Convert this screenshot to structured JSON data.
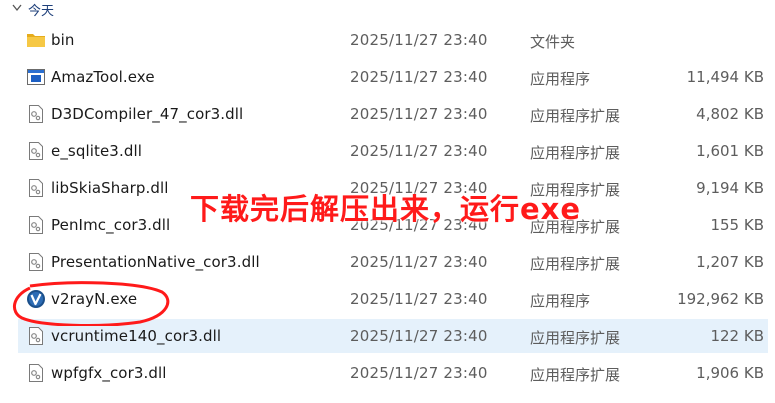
{
  "group": {
    "title": "今天"
  },
  "files": [
    {
      "name": "bin",
      "date": "2025/11/27 23:40",
      "type": "文件夹",
      "size": "",
      "icon": "folder-icon"
    },
    {
      "name": "AmazTool.exe",
      "date": "2025/11/27 23:40",
      "type": "应用程序",
      "size": "11,494 KB",
      "icon": "app-window-icon"
    },
    {
      "name": "D3DCompiler_47_cor3.dll",
      "date": "2025/11/27 23:40",
      "type": "应用程序扩展",
      "size": "4,802 KB",
      "icon": "dll-gear-icon"
    },
    {
      "name": "e_sqlite3.dll",
      "date": "2025/11/27 23:40",
      "type": "应用程序扩展",
      "size": "1,601 KB",
      "icon": "dll-gear-icon"
    },
    {
      "name": "libSkiaSharp.dll",
      "date": "2025/11/27 23:40",
      "type": "应用程序扩展",
      "size": "9,194 KB",
      "icon": "dll-gear-icon"
    },
    {
      "name": "PenImc_cor3.dll",
      "date": "2025/11/27 23:40",
      "type": "应用程序扩展",
      "size": "155 KB",
      "icon": "dll-gear-icon"
    },
    {
      "name": "PresentationNative_cor3.dll",
      "date": "2025/11/27 23:40",
      "type": "应用程序扩展",
      "size": "1,207 KB",
      "icon": "dll-gear-icon"
    },
    {
      "name": "v2rayN.exe",
      "date": "2025/11/27 23:40",
      "type": "应用程序",
      "size": "192,962 KB",
      "icon": "v2rayn-logo-icon"
    },
    {
      "name": "vcruntime140_cor3.dll",
      "date": "2025/11/27 23:40",
      "type": "应用程序扩展",
      "size": "122 KB",
      "icon": "dll-gear-icon"
    },
    {
      "name": "wpfgfx_cor3.dll",
      "date": "2025/11/27 23:40",
      "type": "应用程序扩展",
      "size": "1,906 KB",
      "icon": "dll-gear-icon"
    }
  ],
  "annotation": {
    "text": "下载完后解压出来，运行exe",
    "color": "#ff1a1a"
  },
  "colors": {
    "selected_row": "#e5f1fb",
    "folder": "#f2c230",
    "header_text": "#1e3f7a"
  }
}
